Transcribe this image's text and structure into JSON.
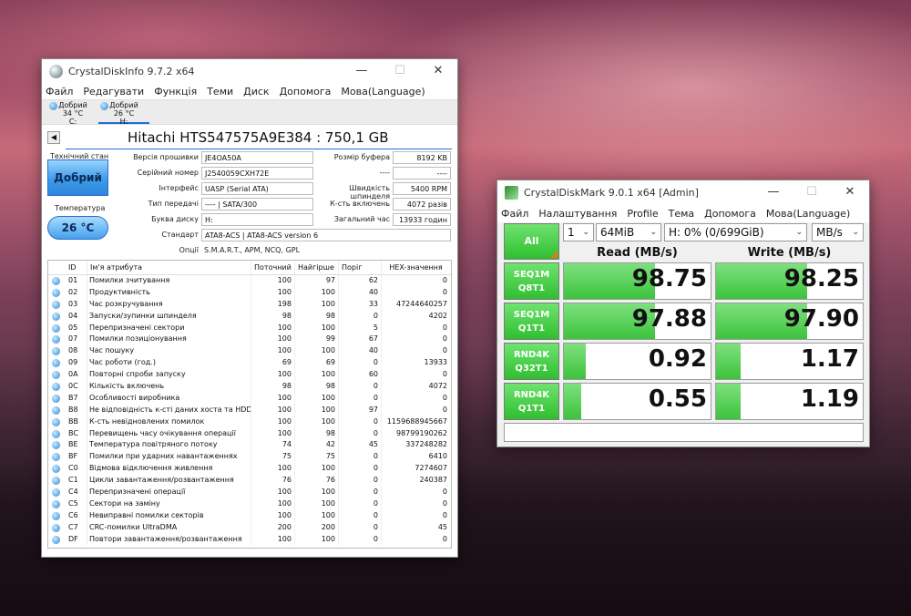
{
  "desktop": {
    "background": "sunset-sky"
  },
  "cdi": {
    "title": "CrystalDiskInfo 9.7.2 x64",
    "menu": [
      "Файл",
      "Редагувати",
      "Функція",
      "Теми",
      "Диск",
      "Допомога",
      "Мова(Language)"
    ],
    "tabs": [
      {
        "status": "Добрий",
        "temp": "34 °C",
        "drive": "C:"
      },
      {
        "status": "Добрий",
        "temp": "26 °C",
        "drive": "H:"
      }
    ],
    "model": "Hitachi HTS547575A9E384 : 750,1 GB",
    "health_label": "Технічний стан",
    "health_value": "Добрий",
    "temp_label": "Температура",
    "temp_value": "26 °C",
    "fields": {
      "firmware_label": "Версія прошивки",
      "firmware": "JE4OA50A",
      "serial_label": "Серійний номер",
      "serial": "J2540059CXH72E",
      "interface_label": "Інтерфейс",
      "interface": "UASP (Serial ATA)",
      "transfer_label": "Тип передачі",
      "transfer": "---- | SATA/300",
      "letter_label": "Буква диску",
      "letter": "H:",
      "standard_label": "Стандарт",
      "standard": "ATA8-ACS | ATA8-ACS version 6",
      "features_label": "Опції",
      "features": "S.M.A.R.T., APM, NCQ, GPL",
      "buffer_label": "Розмір буфера",
      "buffer": "8192 KB",
      "blank_label": "----",
      "blank": "----",
      "rpm_label": "Швидкість шпинделя",
      "rpm": "5400 RPM",
      "count_label": "К-сть включень",
      "count": "4072 разів",
      "hours_label": "Загальний час",
      "hours": "13933 годин"
    },
    "smart_headers": {
      "id": "ID",
      "name": "Ім'я атрибута",
      "current": "Поточний",
      "worst": "Найгірше",
      "threshold": "Поріг",
      "raw": "HEX-значення"
    },
    "smart_rows": [
      {
        "id": "01",
        "name": "Помилки зчитування",
        "cur": "100",
        "worst": "97",
        "thr": "62",
        "raw": "0"
      },
      {
        "id": "02",
        "name": "Продуктивність",
        "cur": "100",
        "worst": "100",
        "thr": "40",
        "raw": "0"
      },
      {
        "id": "03",
        "name": "Час розкручування",
        "cur": "198",
        "worst": "100",
        "thr": "33",
        "raw": "47244640257"
      },
      {
        "id": "04",
        "name": "Запуски/зупинки шпинделя",
        "cur": "98",
        "worst": "98",
        "thr": "0",
        "raw": "4202"
      },
      {
        "id": "05",
        "name": "Перепризначені сектори",
        "cur": "100",
        "worst": "100",
        "thr": "5",
        "raw": "0"
      },
      {
        "id": "07",
        "name": "Помилки позиціонування",
        "cur": "100",
        "worst": "99",
        "thr": "67",
        "raw": "0"
      },
      {
        "id": "08",
        "name": "Час пошуку",
        "cur": "100",
        "worst": "100",
        "thr": "40",
        "raw": "0"
      },
      {
        "id": "09",
        "name": "Час роботи (год.)",
        "cur": "69",
        "worst": "69",
        "thr": "0",
        "raw": "13933"
      },
      {
        "id": "0A",
        "name": "Повторні спроби запуску",
        "cur": "100",
        "worst": "100",
        "thr": "60",
        "raw": "0"
      },
      {
        "id": "0C",
        "name": "Кількість включень",
        "cur": "98",
        "worst": "98",
        "thr": "0",
        "raw": "4072"
      },
      {
        "id": "B7",
        "name": "Особливості виробника",
        "cur": "100",
        "worst": "100",
        "thr": "0",
        "raw": "0"
      },
      {
        "id": "B8",
        "name": "Не відповідність к-сті даних хоста та HDD",
        "cur": "100",
        "worst": "100",
        "thr": "97",
        "raw": "0"
      },
      {
        "id": "BB",
        "name": "К-сть невідновлених помилок",
        "cur": "100",
        "worst": "100",
        "thr": "0",
        "raw": "1159688945667"
      },
      {
        "id": "BC",
        "name": "Перевищень часу очікування операції",
        "cur": "100",
        "worst": "98",
        "thr": "0",
        "raw": "98799190262"
      },
      {
        "id": "BE",
        "name": "Температура повітряного потоку",
        "cur": "74",
        "worst": "42",
        "thr": "45",
        "raw": "337248282"
      },
      {
        "id": "BF",
        "name": "Помилки при ударних навантаженнях",
        "cur": "75",
        "worst": "75",
        "thr": "0",
        "raw": "6410"
      },
      {
        "id": "C0",
        "name": "Відмова відключення живлення",
        "cur": "100",
        "worst": "100",
        "thr": "0",
        "raw": "7274607"
      },
      {
        "id": "C1",
        "name": "Цикли завантаження/розвантаження",
        "cur": "76",
        "worst": "76",
        "thr": "0",
        "raw": "240387"
      },
      {
        "id": "C4",
        "name": "Перепризначені операції",
        "cur": "100",
        "worst": "100",
        "thr": "0",
        "raw": "0"
      },
      {
        "id": "C5",
        "name": "Сектори на заміну",
        "cur": "100",
        "worst": "100",
        "thr": "0",
        "raw": "0"
      },
      {
        "id": "C6",
        "name": "Невиправні помилки секторів",
        "cur": "100",
        "worst": "100",
        "thr": "0",
        "raw": "0"
      },
      {
        "id": "C7",
        "name": "CRC-помилки UltraDMA",
        "cur": "200",
        "worst": "200",
        "thr": "0",
        "raw": "45"
      },
      {
        "id": "DF",
        "name": "Повтори завантаження/розвантаження",
        "cur": "100",
        "worst": "100",
        "thr": "0",
        "raw": "0"
      }
    ]
  },
  "cdm": {
    "title": "CrystalDiskMark 9.0.1 x64 [Admin]",
    "menu": [
      "Файл",
      "Налаштування",
      "Profile",
      "Тема",
      "Допомога",
      "Мова(Language)"
    ],
    "all_label": "All",
    "count": "1",
    "size": "64MiB",
    "drive": "H: 0% (0/699GiB)",
    "unit": "MB/s",
    "read_header": "Read (MB/s)",
    "write_header": "Write (MB/s)",
    "tests": [
      {
        "line1": "SEQ1M",
        "line2": "Q8T1",
        "read": "98.75",
        "write": "98.25",
        "read_fill": 0.62,
        "write_fill": 0.62
      },
      {
        "line1": "SEQ1M",
        "line2": "Q1T1",
        "read": "97.88",
        "write": "97.90",
        "read_fill": 0.62,
        "write_fill": 0.62
      },
      {
        "line1": "RND4K",
        "line2": "Q32T1",
        "read": "0.92",
        "write": "1.17",
        "read_fill": 0.15,
        "write_fill": 0.17
      },
      {
        "line1": "RND4K",
        "line2": "Q1T1",
        "read": "0.55",
        "write": "1.19",
        "read_fill": 0.12,
        "write_fill": 0.17
      }
    ],
    "accent": "#3cc33c"
  }
}
